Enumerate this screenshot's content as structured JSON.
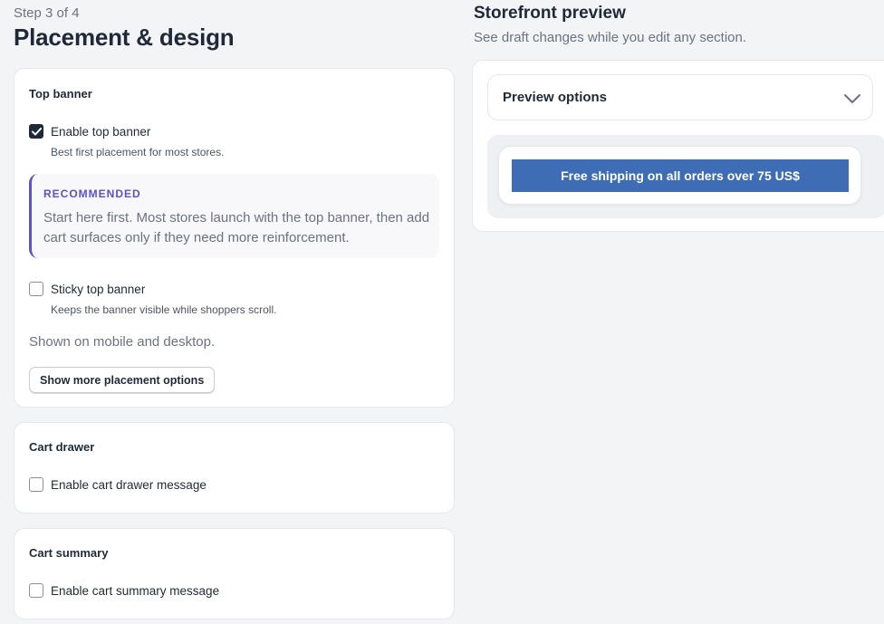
{
  "header": {
    "step": "Step 3 of 4",
    "title": "Placement & design"
  },
  "top_banner": {
    "title": "Top banner",
    "enable": {
      "label": "Enable top banner",
      "checked": true,
      "help": "Best first placement for most stores."
    },
    "recommended": {
      "tag": "RECOMMENDED",
      "text": "Start here first. Most stores launch with the top banner, then add cart surfaces only if they need more reinforcement."
    },
    "sticky": {
      "label": "Sticky top banner",
      "checked": false,
      "help": "Keeps the banner visible while shoppers scroll."
    },
    "shown_on": "Shown on mobile and desktop.",
    "more_button": "Show more placement options"
  },
  "cart_drawer": {
    "title": "Cart drawer",
    "enable": {
      "label": "Enable cart drawer message",
      "checked": false
    }
  },
  "cart_summary": {
    "title": "Cart summary",
    "enable": {
      "label": "Enable cart summary message",
      "checked": false
    }
  },
  "preview": {
    "title": "Storefront preview",
    "subtitle": "See draft changes while you edit any section.",
    "options_label": "Preview options",
    "options_icon": "chevron-down-icon",
    "banner_text": "Free shipping on all orders over 75 US$"
  },
  "colors": {
    "accent": "#5b52c7",
    "banner": "#3f6db5",
    "checkbox_checked": "#1f2937"
  }
}
